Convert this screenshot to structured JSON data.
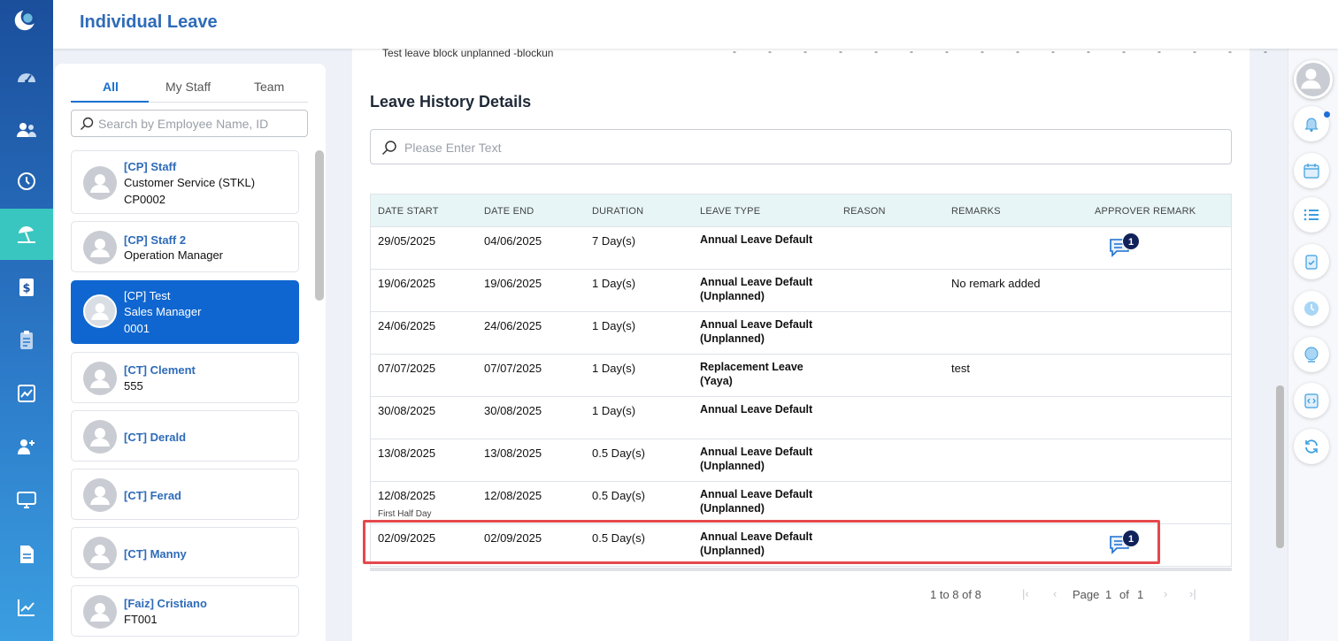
{
  "header": {
    "title": "Individual Leave"
  },
  "employee_panel": {
    "tabs": [
      {
        "label": "All"
      },
      {
        "label": "My Staff"
      },
      {
        "label": "Team"
      }
    ],
    "search_placeholder": "Search by Employee Name, ID",
    "employees": [
      {
        "name": "[CP] Staff",
        "lines": [
          "Customer Service (STKL)",
          "CP0002"
        ]
      },
      {
        "name": "[CP] Staff 2",
        "lines": [
          "Operation Manager"
        ]
      },
      {
        "name": "[CP] Test",
        "lines": [
          "Sales Manager",
          "0001"
        ],
        "selected": true
      },
      {
        "name": "[CT] Clement",
        "lines": [
          "555"
        ]
      },
      {
        "name": "[CT] Derald",
        "lines": []
      },
      {
        "name": "[CT] Ferad",
        "lines": []
      },
      {
        "name": "[CT] Manny",
        "lines": []
      },
      {
        "name": "[Faiz] Cristiano",
        "lines": [
          "FT001"
        ]
      }
    ]
  },
  "main": {
    "top_row_text": "Test leave block unplanned -blockun",
    "top_row_dashes": "----------------",
    "section_title": "Leave History Details",
    "search_placeholder": "Please Enter Text",
    "table": {
      "headers": [
        "DATE START",
        "DATE END",
        "DURATION",
        "LEAVE TYPE",
        "REASON",
        "REMARKS",
        "APPROVER REMARK"
      ],
      "rows": [
        {
          "date_start": "29/05/2025",
          "date_end": "04/06/2025",
          "duration": "7 Day(s)",
          "leave_type": [
            "Annual Leave Default"
          ],
          "reason": "",
          "remarks": "",
          "approver_remark_count": "1"
        },
        {
          "date_start": "19/06/2025",
          "date_end": "19/06/2025",
          "duration": "1 Day(s)",
          "leave_type": [
            "Annual Leave Default",
            "(Unplanned)"
          ],
          "reason": "",
          "remarks": "No remark added",
          "approver_remark_count": ""
        },
        {
          "date_start": "24/06/2025",
          "date_end": "24/06/2025",
          "duration": "1 Day(s)",
          "leave_type": [
            "Annual Leave Default",
            "(Unplanned)"
          ],
          "reason": "",
          "remarks": "",
          "approver_remark_count": ""
        },
        {
          "date_start": "07/07/2025",
          "date_end": "07/07/2025",
          "duration": "1 Day(s)",
          "leave_type": [
            "Replacement Leave",
            "(Yaya)"
          ],
          "reason": "",
          "remarks": "test",
          "approver_remark_count": ""
        },
        {
          "date_start": "30/08/2025",
          "date_end": "30/08/2025",
          "duration": "1 Day(s)",
          "leave_type": [
            "Annual Leave Default"
          ],
          "reason": "",
          "remarks": "",
          "approver_remark_count": ""
        },
        {
          "date_start": "13/08/2025",
          "date_end": "13/08/2025",
          "duration": "0.5 Day(s)",
          "leave_type": [
            "Annual Leave Default",
            "(Unplanned)"
          ],
          "reason": "",
          "remarks": "",
          "approver_remark_count": ""
        },
        {
          "date_start": "12/08/2025",
          "date_start_note": "First Half Day",
          "date_end": "12/08/2025",
          "duration": "0.5 Day(s)",
          "leave_type": [
            "Annual Leave Default",
            "(Unplanned)"
          ],
          "reason": "",
          "remarks": "",
          "approver_remark_count": ""
        },
        {
          "date_start": "02/09/2025",
          "date_end": "02/09/2025",
          "duration": "0.5 Day(s)",
          "leave_type": [
            "Annual Leave Default",
            "(Unplanned)"
          ],
          "reason": "",
          "remarks": "",
          "approver_remark_count": "1",
          "highlighted": true
        }
      ]
    },
    "pagination": {
      "range": "1 to 8 of 8",
      "page_label": "Page",
      "current_page": "1",
      "of_label": "of",
      "total_pages": "1"
    }
  },
  "left_rail_icons": [
    "moon-logo-icon",
    "dashboard-gauge-icon",
    "people-icon",
    "history-clock-icon",
    "beach-umbrella-icon",
    "dollar-document-icon",
    "clipboard-icon",
    "line-chart-icon",
    "add-user-icon",
    "monitor-icon",
    "document-icon",
    "trend-chart-icon"
  ],
  "right_rail_icons": [
    "user-avatar",
    "bell-icon",
    "calendar-icon",
    "list-icon",
    "clipboard-check-icon",
    "clock-icon",
    "globe-icon",
    "code-icon",
    "refresh-icon"
  ],
  "colors": {
    "brand_blue": "#2e6bb8",
    "selected_blue": "#0f66d0",
    "active_nav": "#39c6c0",
    "highlight_red": "#e5484d",
    "badge_navy": "#11215a",
    "table_header": "#e7f5f6"
  }
}
